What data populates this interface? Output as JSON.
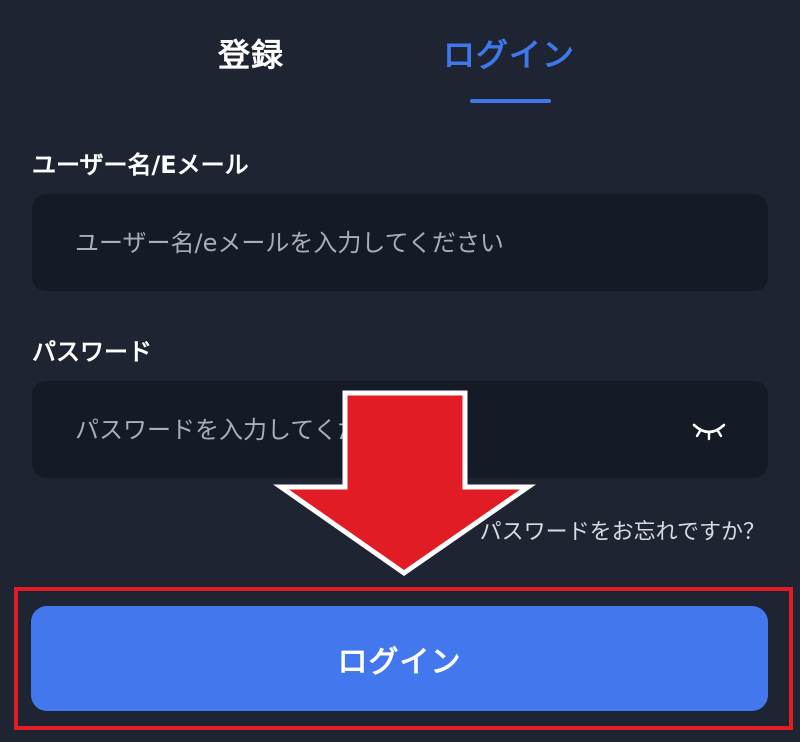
{
  "tabs": {
    "register_label": "登録",
    "login_label": "ログイン",
    "active_tab": "ログイン"
  },
  "form": {
    "username": {
      "label": "ユーザー名/Eメール",
      "placeholder": "ユーザー名/eメールを入力してください",
      "value": ""
    },
    "password": {
      "label": "パスワード",
      "placeholder": "パスワードを入力してください",
      "value": ""
    },
    "forgot_password_link": "パスワードをお忘れですか？",
    "login_button_label": "ログイン"
  },
  "icons": {
    "password_toggle": "eye-closed-icon",
    "annotation": "down-arrow-icon"
  },
  "colors": {
    "background": "#1f2433",
    "input_background": "#141a26",
    "accent": "#3f78ea",
    "button": "#4377ee",
    "annotation_red": "#e11c24"
  }
}
